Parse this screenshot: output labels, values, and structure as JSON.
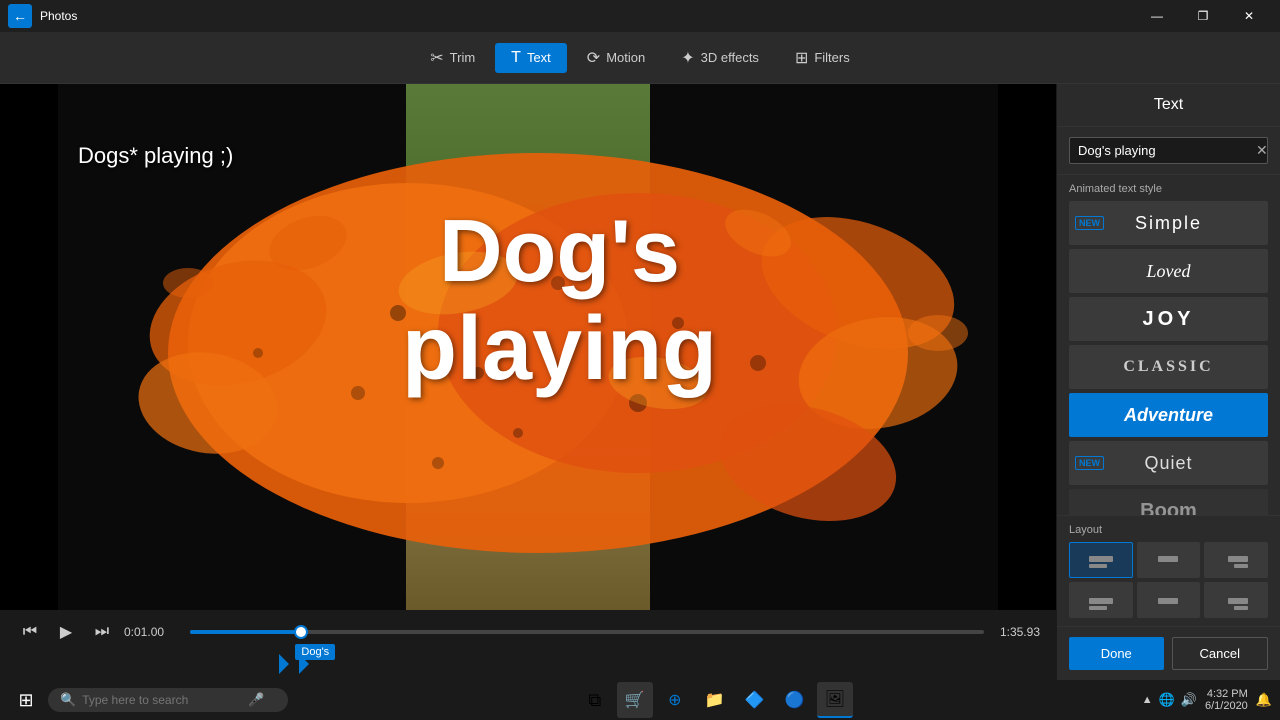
{
  "titlebar": {
    "app_name": "Photos",
    "back_label": "←",
    "minimize": "—",
    "maximize": "❐",
    "close": "✕"
  },
  "toolbar": {
    "trim_label": "Trim",
    "text_label": "Text",
    "motion_label": "Motion",
    "effects_label": "3D effects",
    "filters_label": "Filters"
  },
  "video": {
    "overlay_title": "Dogs* playing ;)",
    "overlay_line1": "Dog's",
    "overlay_line2": "playing",
    "time_current": "0:01.00",
    "time_end": "1:35.93",
    "clip_label": "Dog's"
  },
  "panel": {
    "title": "Text",
    "text_value": "Dog's playing",
    "clear_label": "✕",
    "style_section_label": "Animated text style",
    "styles": [
      {
        "id": "simple",
        "label": "Simple",
        "new": true,
        "selected": false
      },
      {
        "id": "loved",
        "label": "Loved",
        "new": false,
        "selected": false
      },
      {
        "id": "joy",
        "label": "JOY",
        "new": false,
        "selected": false
      },
      {
        "id": "classic",
        "label": "CLASSIC",
        "new": false,
        "selected": false
      },
      {
        "id": "adventure",
        "label": "Adventure",
        "new": false,
        "selected": true
      },
      {
        "id": "quiet",
        "label": "Quiet",
        "new": true,
        "selected": false
      },
      {
        "id": "boom",
        "label": "Boom",
        "new": false,
        "selected": false
      }
    ],
    "layout_label": "Layout",
    "done_label": "Done",
    "cancel_label": "Cancel"
  },
  "taskbar": {
    "search_placeholder": "Type here to search",
    "time": "4:32 PM",
    "date": "6/1/2020"
  }
}
